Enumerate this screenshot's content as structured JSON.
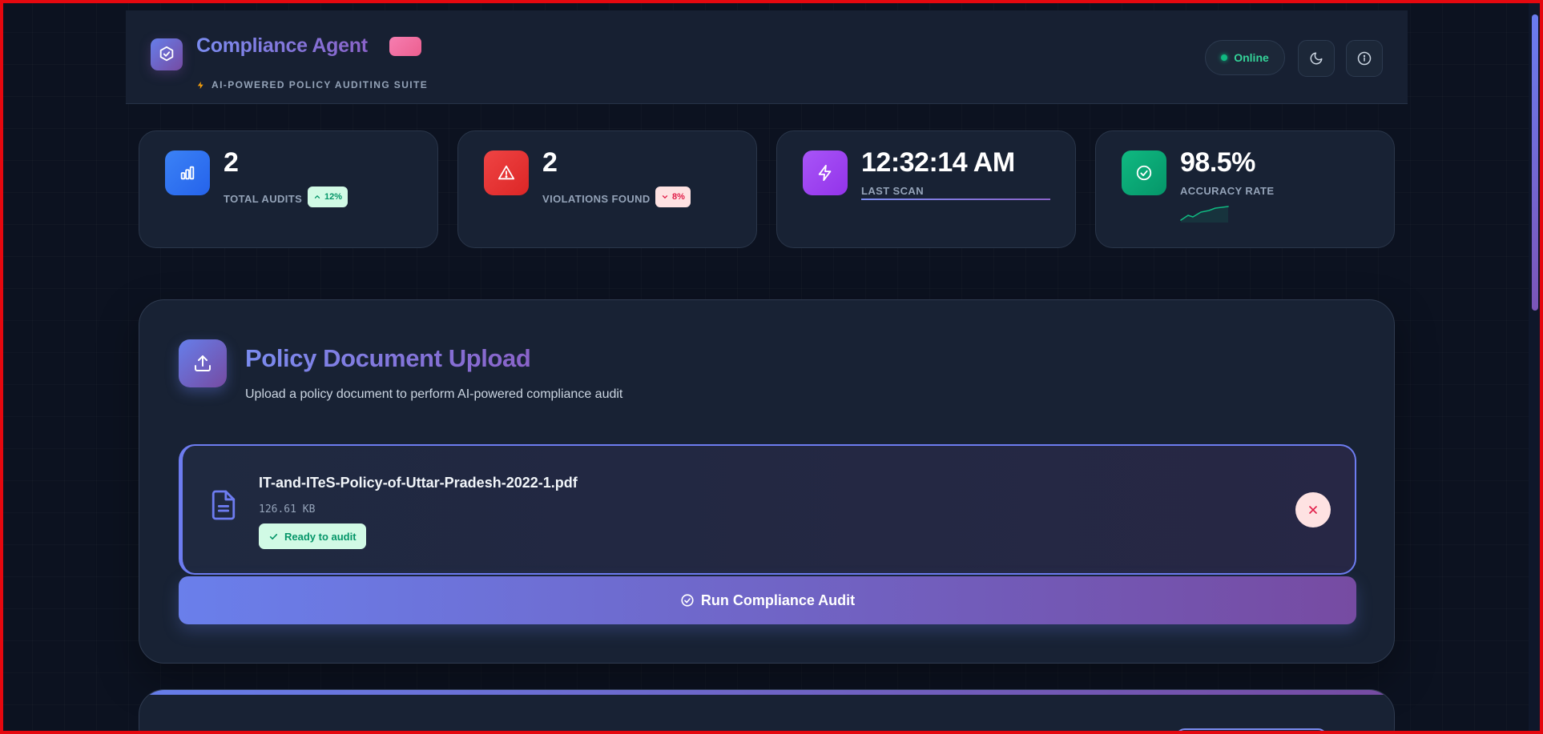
{
  "header": {
    "title": "Compliance Agent",
    "subtitle": "AI-POWERED POLICY AUDITING SUITE",
    "status": "Online",
    "icons": {
      "logo": "shield-check-icon",
      "subtitle": "lightning-icon",
      "theme": "moon-icon",
      "info": "info-icon"
    }
  },
  "stats": [
    {
      "value": "2",
      "label": "TOTAL AUDITS",
      "change": "12%",
      "icon": "bar-chart-icon",
      "color": "#3b82f6"
    },
    {
      "value": "2",
      "label": "VIOLATIONS FOUND",
      "change": "8%",
      "icon": "warning-triangle-icon",
      "color": "#ef4444"
    },
    {
      "value": "12:32:14 AM",
      "label": "LAST SCAN",
      "icon": "lightning-icon",
      "color": "#a855f7"
    },
    {
      "value": "98.5%",
      "label": "ACCURACY RATE",
      "icon": "check-circle-icon",
      "color": "#10b981"
    }
  ],
  "upload": {
    "title": "Policy Document Upload",
    "description": "Upload a policy document to perform AI-powered compliance audit",
    "file": {
      "name": "IT-and-ITeS-Policy-of-Uttar-Pradesh-2022-1.pdf",
      "size": "126.61 KB",
      "status": "Ready to audit"
    },
    "run_button": "Run Compliance Audit"
  },
  "colors": {
    "accent_start": "#667eea",
    "accent_end": "#764ba2",
    "success": "#10b981",
    "danger": "#ef4444"
  }
}
